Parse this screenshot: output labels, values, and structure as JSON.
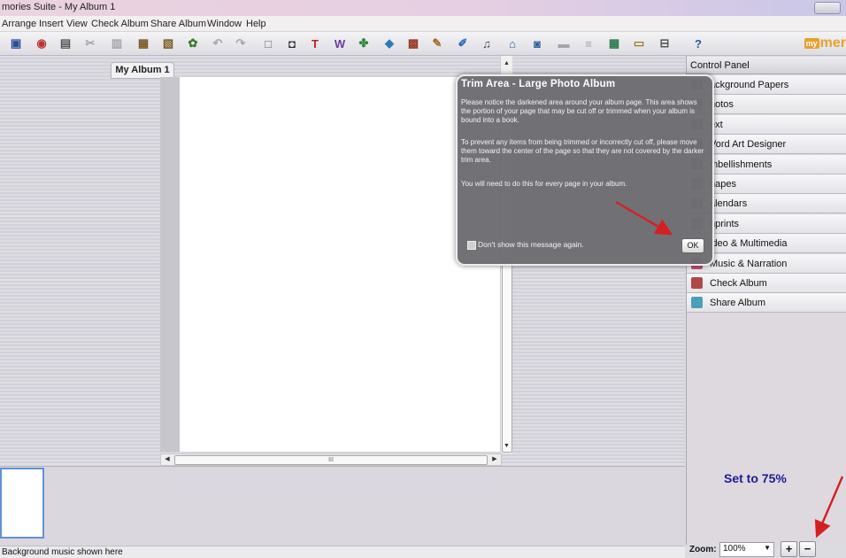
{
  "window": {
    "title": "mories Suite   - My Album 1"
  },
  "menu": [
    "Arrange",
    "Insert",
    "View",
    "Check Album",
    "Share Album",
    "Window",
    "Help"
  ],
  "toolbar": {
    "icons": [
      "save-icon",
      "open-icon",
      "print-icon",
      "cut-icon",
      "copy-icon",
      "paste-icon",
      "paste-special-icon",
      "settings-icon",
      "undo-icon",
      "redo-icon",
      "new-page-icon",
      "camera-icon",
      "text-icon",
      "word-art-icon",
      "embellishment-icon",
      "shape-icon",
      "calendar-icon",
      "imprint-icon",
      "pen-icon",
      "video-icon",
      "music-icon",
      "check-album-icon",
      "share-album-icon",
      "layer-back-icon",
      "align-icon",
      "grid-icon",
      "page-icon",
      "cart-icon",
      "help-icon"
    ],
    "brand": {
      "box": "my",
      "text": "mer"
    }
  },
  "workspace": {
    "tab_label": "My Album 1",
    "hscroll_grip": "III"
  },
  "dialog": {
    "title": "Trim Area - Large Photo Album",
    "paragraph1": "Please notice the darkened area around your album page. This area shows the portion of your page that may be cut off or trimmed when your album is bound into a book.",
    "paragraph2": "To prevent any items from being trimmed or incorrectly cut off, please move them toward the center of the page so that they are not covered by the darker trim area.",
    "paragraph3": "You will need to do this for every page in your album.",
    "checkbox_label": "Don't show this message again.",
    "ok_label": "OK"
  },
  "control_panel": {
    "header": "Control Panel",
    "items": [
      {
        "label": "ackground Papers",
        "icon": "background-papers-icon",
        "color": "#8f8f96"
      },
      {
        "label": "hotos",
        "icon": "photos-icon",
        "color": "#8f8f96"
      },
      {
        "label": "ext",
        "icon": "text-icon",
        "color": "#8f8f96"
      },
      {
        "label": "Vord Art Designer",
        "icon": "word-art-icon",
        "color": "#8f8f96"
      },
      {
        "label": "mbellishments",
        "icon": "embellishments-icon",
        "color": "#8f8f96"
      },
      {
        "label": "hapes",
        "icon": "shapes-icon",
        "color": "#8f8f96"
      },
      {
        "label": "alendars",
        "icon": "calendars-icon",
        "color": "#8f8f96"
      },
      {
        "label": "nprints",
        "icon": "imprints-icon",
        "color": "#8f8f96"
      },
      {
        "label": "ideo & Multimedia",
        "icon": "video-icon",
        "color": "#8f8f96"
      },
      {
        "label": "Music & Narration",
        "icon": "music-icon",
        "color": "#c05068"
      },
      {
        "label": "Check Album",
        "icon": "check-album-icon",
        "color": "#b04848"
      },
      {
        "label": "Share Album",
        "icon": "share-album-icon",
        "color": "#4aa0b8"
      }
    ]
  },
  "annotation": {
    "text": "Set to 75%",
    "arrow_color": "#d42020"
  },
  "zoom": {
    "label": "Zoom:",
    "value": "100%",
    "plus": "+",
    "minus": "−"
  },
  "status": {
    "text": "Background music shown here"
  }
}
